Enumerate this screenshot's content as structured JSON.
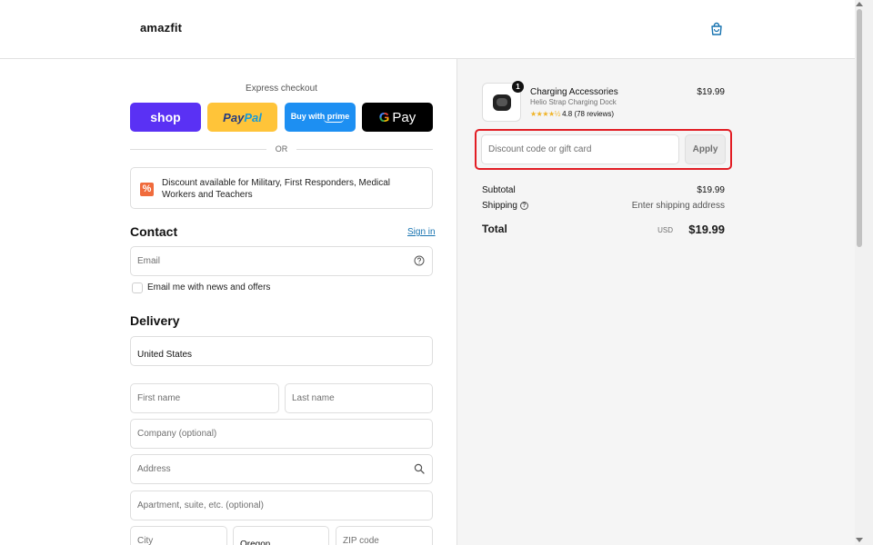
{
  "header": {
    "logo_text": "amazfit",
    "cart_icon": "shopping-bag-icon"
  },
  "express": {
    "label": "Express checkout",
    "buttons": {
      "shop": "shop",
      "paypal_pay": "Pay",
      "paypal_pal": "Pal",
      "amazon": "Buy with prime",
      "gpay_g": "G",
      "gpay_text": "Pay"
    },
    "or": "OR"
  },
  "notice": {
    "icon": "percent-tag-icon",
    "text": "Discount available for Military, First Responders, Medical Workers and Teachers"
  },
  "contact": {
    "heading": "Contact",
    "signin": "Sign in",
    "email_placeholder": "Email",
    "newsletter_label": "Email me with news and offers"
  },
  "delivery": {
    "heading": "Delivery",
    "country": "United States",
    "first_name": "First name",
    "last_name": "Last name",
    "company": "Company (optional)",
    "address": "Address",
    "apartment": "Apartment, suite, etc. (optional)",
    "city": "City",
    "state": "Oregon",
    "zip": "ZIP code"
  },
  "order": {
    "quantity": "1",
    "product_title": "Charging Accessories",
    "product_variant": "Helio Strap Charging Dock",
    "stars": "★★★★½",
    "rating": "4.8 (78 reviews)",
    "price": "$19.99",
    "discount_placeholder": "Discount code or gift card",
    "apply_label": "Apply",
    "subtotal_label": "Subtotal",
    "subtotal_value": "$19.99",
    "shipping_label": "Shipping",
    "shipping_value": "Enter shipping address",
    "total_label": "Total",
    "currency": "USD",
    "total_value": "$19.99"
  },
  "colors": {
    "shop": "#5a31f4",
    "paypal": "#ffc439",
    "amazon": "#1d8ff2",
    "gpay": "#000000",
    "link": "#1773b0",
    "highlight": "#e21d24"
  }
}
